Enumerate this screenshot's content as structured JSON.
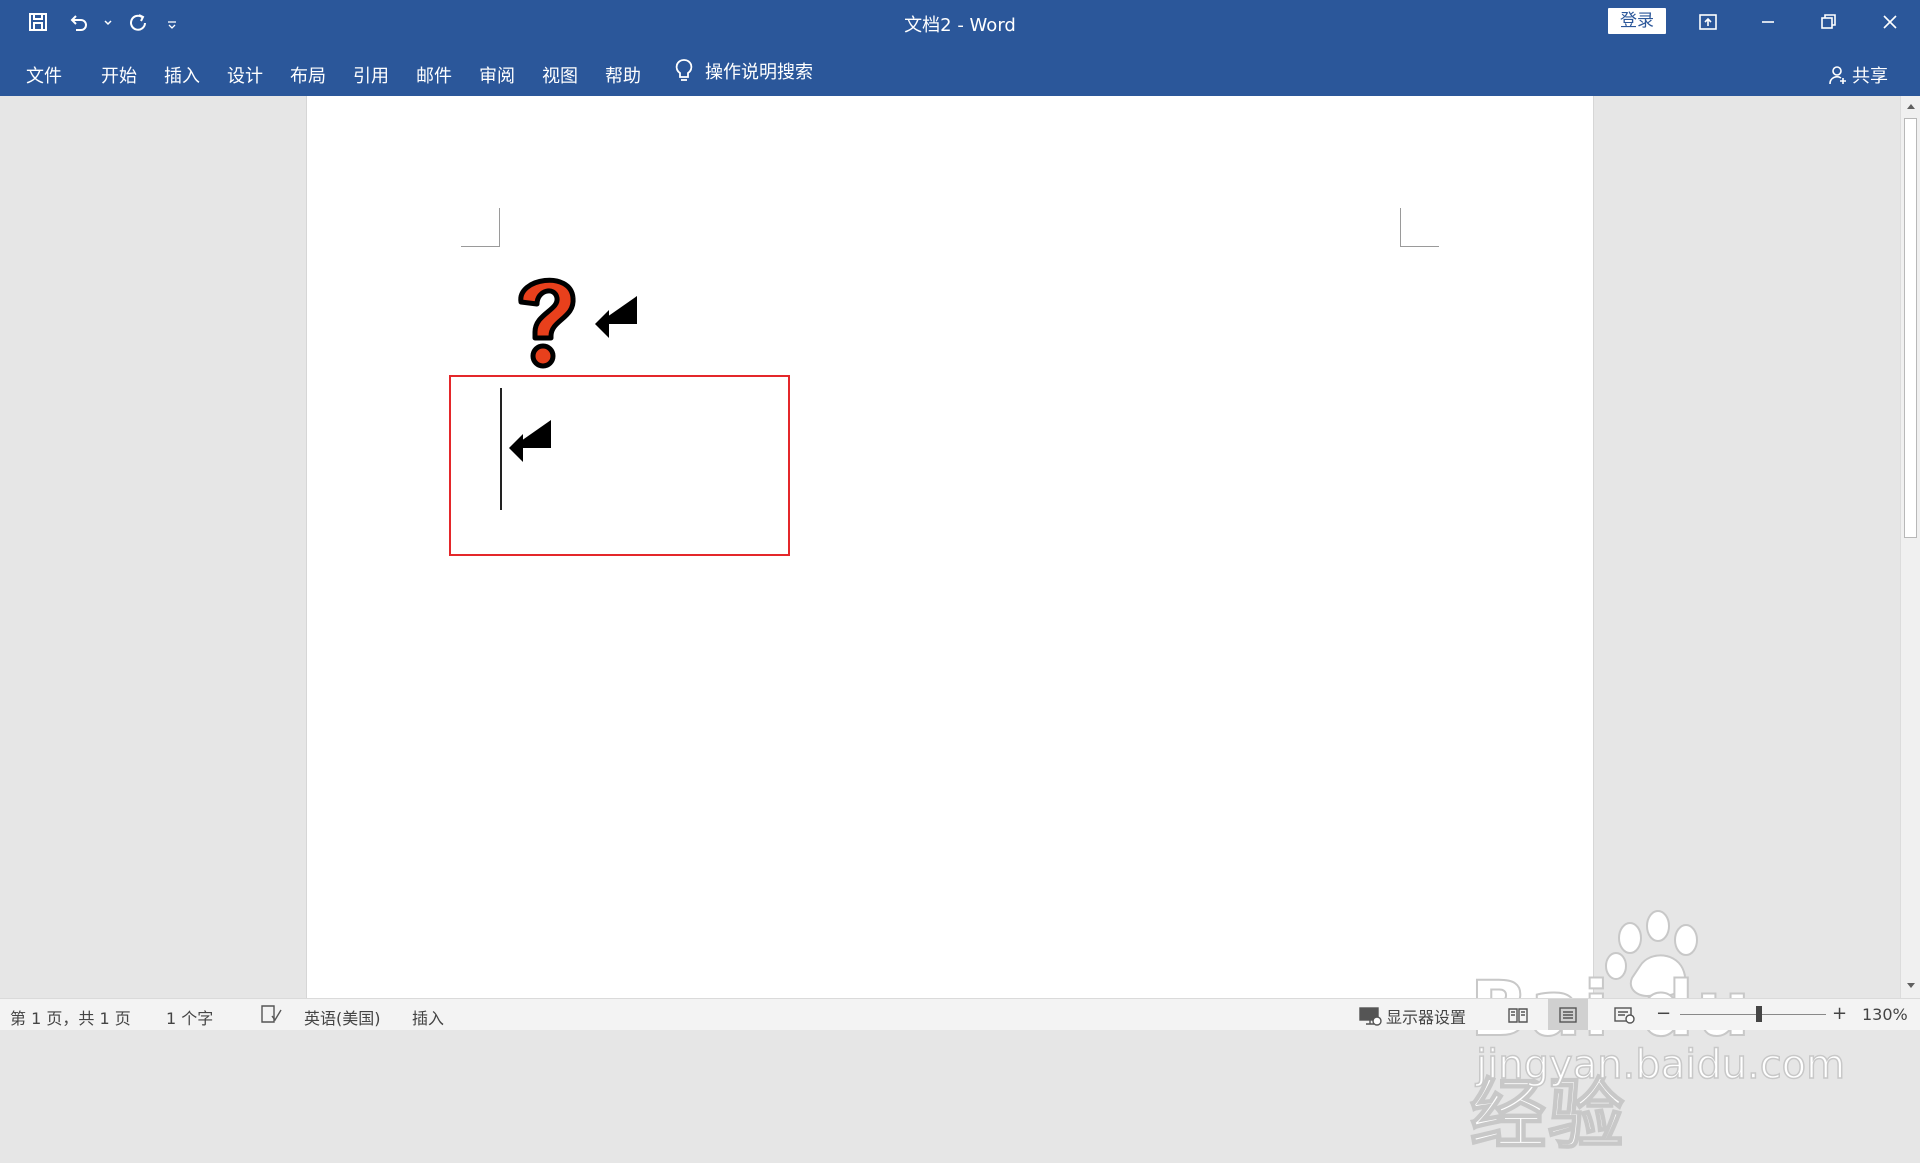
{
  "titlebar": {
    "title": "文档2  -  Word",
    "login_label": "登录",
    "qat_icons": [
      "save-icon",
      "undo-icon",
      "undo-dropdown-icon",
      "redo-icon",
      "customize-qat-icon"
    ],
    "window_icons": [
      "ribbon-display-icon",
      "minimize-icon",
      "restore-icon",
      "close-icon"
    ]
  },
  "ribbon": {
    "tabs": [
      {
        "label": "文件"
      },
      {
        "label": "开始"
      },
      {
        "label": "插入"
      },
      {
        "label": "设计"
      },
      {
        "label": "布局"
      },
      {
        "label": "引用"
      },
      {
        "label": "邮件"
      },
      {
        "label": "审阅"
      },
      {
        "label": "视图"
      },
      {
        "label": "帮助"
      }
    ],
    "tell_me": "操作说明搜索",
    "share": "共享"
  },
  "document": {
    "symbols": [
      "question-mark-icon",
      "paragraph-mark-icon",
      "paragraph-mark-icon"
    ],
    "highlight_color": "#e4272a"
  },
  "watermark": {
    "logo_text": "Bai du 经验",
    "url_text": "jingyan.baidu.com"
  },
  "statusbar": {
    "page_info": "第 1 页，共 1 页",
    "word_count": "1 个字",
    "language": "英语(美国)",
    "mode": "插入",
    "display_settings": "显示器设置",
    "zoom_minus": "−",
    "zoom_plus": "+",
    "zoom_level": "130%"
  },
  "colors": {
    "brand": "#2b579a",
    "page": "#ffffff",
    "workspace": "#e6e6e6"
  }
}
